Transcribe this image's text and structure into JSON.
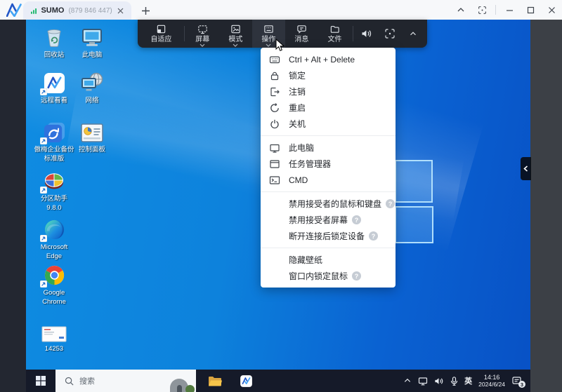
{
  "colors": {
    "titlebar_bg": "#f7f8fa",
    "tab_bg": "#e9edf7",
    "toolbar_bg": "#21252d",
    "taskbar_bg": "#151a29",
    "desktop_blue": "#0d82dc",
    "signal_green": "#19b66a",
    "brand_blue_dark": "#2356c7",
    "brand_blue_light": "#42a4f5"
  },
  "titlebar": {
    "tab_title": "SUMO",
    "tab_session_id": "(879 846 447)"
  },
  "toolbar": {
    "items": [
      {
        "label": "自适应",
        "icon": "fit-screen-icon"
      },
      {
        "label": "屏幕",
        "icon": "screen-icon"
      },
      {
        "label": "模式",
        "icon": "display-mode-icon"
      },
      {
        "label": "操作",
        "icon": "operation-icon",
        "active": true
      },
      {
        "label": "消息",
        "icon": "message-icon"
      },
      {
        "label": "文件",
        "icon": "file-transfer-icon"
      }
    ]
  },
  "menu": {
    "help_glyph": "?",
    "items": [
      {
        "label": "Ctrl + Alt + Delete",
        "icon": "keyboard-icon"
      },
      {
        "label": "锁定",
        "icon": "lock-icon"
      },
      {
        "label": "注销",
        "icon": "logout-icon"
      },
      {
        "label": "重启",
        "icon": "restart-icon"
      },
      {
        "label": "关机",
        "icon": "power-icon"
      },
      {
        "label": "此电脑",
        "icon": "monitor-icon"
      },
      {
        "label": "任务管理器",
        "icon": "window-icon"
      },
      {
        "label": "CMD",
        "icon": "terminal-icon"
      },
      {
        "label": "禁用接受者的鼠标和键盘",
        "help": true
      },
      {
        "label": "禁用接受者屏幕",
        "help": true
      },
      {
        "label": "断开连接后锁定设备",
        "help": true
      },
      {
        "label": "隐藏壁纸"
      },
      {
        "label": "窗口内锁定鼠标",
        "help": true
      }
    ]
  },
  "desktop": {
    "icons": [
      {
        "label": "回收站"
      },
      {
        "label": "此电脑"
      },
      {
        "label": "远程看看"
      },
      {
        "label": "网络"
      },
      {
        "label": "傲梅企业备份",
        "label2": "标准版"
      },
      {
        "label": "控制面板"
      },
      {
        "label": "分区助手",
        "label2": "9.8.0"
      },
      {
        "label": "Microsoft",
        "label2": "Edge"
      },
      {
        "label": "Google",
        "label2": "Chrome"
      },
      {
        "label": "14253"
      }
    ]
  },
  "taskbar": {
    "search_placeholder": "搜索",
    "tray": {
      "input_language": "英",
      "time": "14:16",
      "date": "2024/6/24",
      "notification_count": "3"
    }
  }
}
